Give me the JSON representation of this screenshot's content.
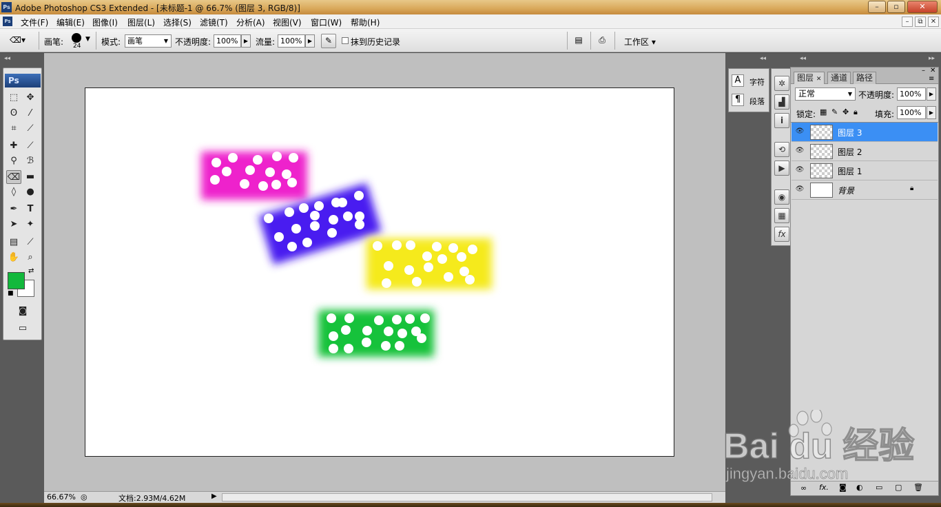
{
  "window": {
    "title": "Adobe Photoshop CS3 Extended - [未标题-1 @ 66.7% (图层 3, RGB/8)]",
    "app_icon": "Ps"
  },
  "menubar": {
    "items": [
      "文件(F)",
      "编辑(E)",
      "图像(I)",
      "图层(L)",
      "选择(S)",
      "滤镜(T)",
      "分析(A)",
      "视图(V)",
      "窗口(W)",
      "帮助(H)"
    ]
  },
  "options": {
    "brush_label": "画笔:",
    "brush_size": "24",
    "mode_label": "模式:",
    "mode_value": "画笔",
    "opacity_label": "不透明度:",
    "opacity_value": "100%",
    "flow_label": "流量:",
    "flow_value": "100%",
    "erase_history_label": "抹到历史记录",
    "workspace_label": "工作区"
  },
  "toolbox": {
    "logo": "Ps",
    "foreground_color": "#12b83c",
    "background_color": "#ffffff"
  },
  "side_dock": {
    "char_label": "字符",
    "para_label": "段落"
  },
  "layers_panel": {
    "tabs": [
      "图层",
      "通道",
      "路径"
    ],
    "blend_mode": "正常",
    "opacity_label": "不透明度:",
    "opacity_value": "100%",
    "lock_label": "锁定:",
    "fill_label": "填充:",
    "fill_value": "100%",
    "layers": [
      {
        "name": "图层 3",
        "selected": true
      },
      {
        "name": "图层 2",
        "selected": false
      },
      {
        "name": "图层 1",
        "selected": false
      },
      {
        "name": "背景",
        "selected": false,
        "locked": true
      }
    ]
  },
  "statusbar": {
    "zoom": "66.67%",
    "doc_info": "文档:2.93M/4.62M"
  },
  "artwork": {
    "blocks": [
      {
        "color": "#ee22cc",
        "name": "magenta"
      },
      {
        "color": "#4a1ff0",
        "name": "purple"
      },
      {
        "color": "#f5ea1a",
        "name": "yellow"
      },
      {
        "color": "#16c23a",
        "name": "green"
      }
    ]
  },
  "watermark": {
    "brand": "Bai du 经验",
    "url": "jingyan.baidu.com"
  }
}
